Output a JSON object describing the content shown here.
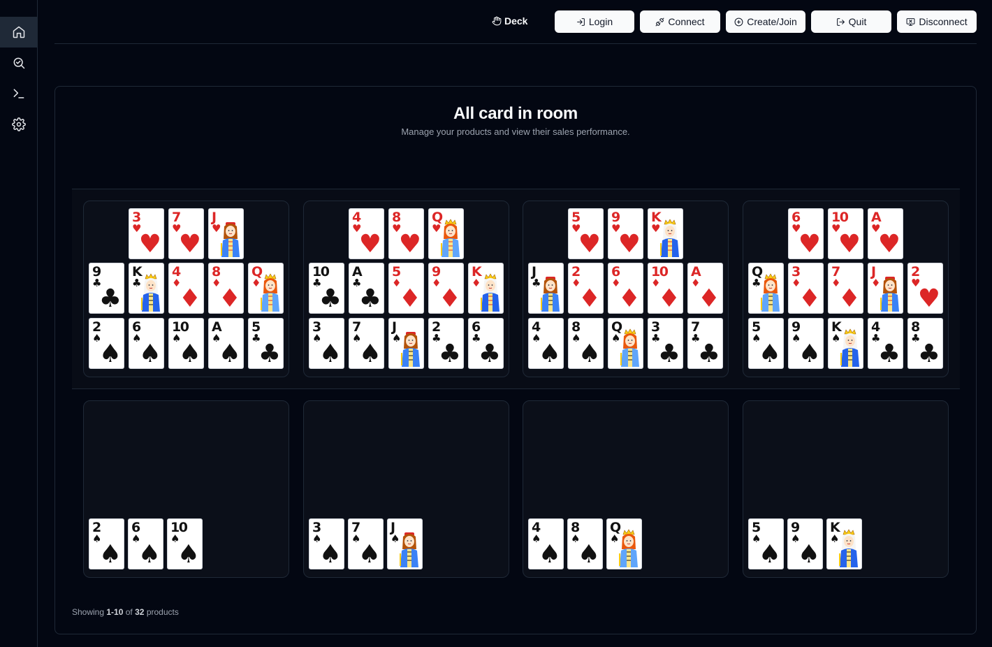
{
  "header": {
    "deck_label": "Deck",
    "buttons": {
      "login": "Login",
      "connect": "Connect",
      "create_join": "Create/Join",
      "quit": "Quit",
      "disconnect": "Disconnect"
    }
  },
  "sidebar": {
    "items": [
      {
        "name": "home",
        "icon": "home-icon",
        "active": true
      },
      {
        "name": "search",
        "icon": "search-check-icon",
        "active": false
      },
      {
        "name": "terminal",
        "icon": "terminal-icon",
        "active": false
      },
      {
        "name": "settings",
        "icon": "gear-icon",
        "active": false
      }
    ]
  },
  "main": {
    "title": "All card in room",
    "subtitle": "Manage your products and view their sales performance."
  },
  "footer": {
    "prefix": "Showing",
    "range": "1-10",
    "of": "of",
    "total": "32",
    "suffix": "products"
  },
  "colors": {
    "background": "#030712",
    "red_suit": "#dc2626",
    "black_suit": "#111111"
  },
  "players": [
    {
      "hand": [
        [
          "3♥",
          "7♥",
          "J♥"
        ],
        [
          "9♣",
          "K♣",
          "4♦",
          "8♦",
          "Q♦"
        ],
        [
          "2♠",
          "6♠",
          "10♠",
          "A♠",
          "5♣"
        ]
      ],
      "played": [
        "2♠",
        "6♠",
        "10♠"
      ]
    },
    {
      "hand": [
        [
          "4♥",
          "8♥",
          "Q♥"
        ],
        [
          "10♣",
          "A♣",
          "5♦",
          "9♦",
          "K♦"
        ],
        [
          "3♠",
          "7♠",
          "J♠",
          "2♣",
          "6♣"
        ]
      ],
      "played": [
        "3♠",
        "7♠",
        "J♠"
      ]
    },
    {
      "hand": [
        [
          "5♥",
          "9♥",
          "K♥"
        ],
        [
          "J♣",
          "2♦",
          "6♦",
          "10♦",
          "A♦"
        ],
        [
          "4♠",
          "8♠",
          "Q♠",
          "3♣",
          "7♣"
        ]
      ],
      "played": [
        "4♠",
        "8♠",
        "Q♠"
      ]
    },
    {
      "hand": [
        [
          "6♥",
          "10♥",
          "A♥"
        ],
        [
          "Q♣",
          "3♦",
          "7♦",
          "J♦",
          "2♥"
        ],
        [
          "5♠",
          "9♠",
          "K♠",
          "4♣",
          "8♣"
        ]
      ],
      "played": [
        "5♠",
        "9♠",
        "K♠"
      ]
    }
  ]
}
